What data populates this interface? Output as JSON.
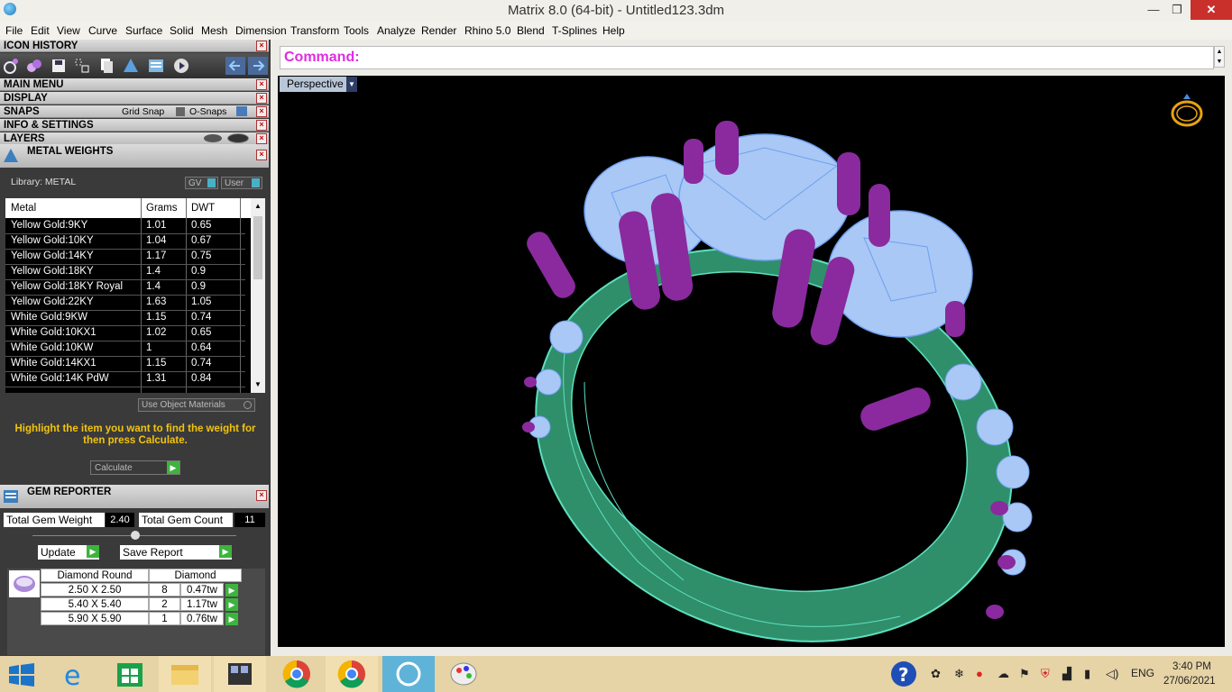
{
  "window": {
    "title": "Matrix 8.0 (64-bit) - Untitled123.3dm",
    "minimize": "—",
    "maximize": "❐",
    "close": "✕"
  },
  "menu": [
    "File",
    "Edit",
    "View",
    "Curve",
    "Surface",
    "Solid",
    "Mesh",
    "Dimension",
    "Transform",
    "Tools",
    "Analyze",
    "Render",
    "Rhino 5.0",
    "Blend",
    "T-Splines",
    "Help"
  ],
  "panels": {
    "icon_history": "ICON HISTORY",
    "main_menu": "MAIN MENU",
    "display": "DISPLAY",
    "snaps": "SNAPS",
    "grid_snap": "Grid Snap",
    "o_snaps": "O-Snaps",
    "info_settings": "INFO & SETTINGS",
    "layers": "LAYERS"
  },
  "metal_weights": {
    "title": "METAL WEIGHTS",
    "library": "Library: METAL",
    "gv": "GV",
    "user": "User",
    "columns": [
      "Metal",
      "Grams",
      "DWT"
    ],
    "rows": [
      [
        "Yellow Gold:9KY",
        "1.01",
        "0.65"
      ],
      [
        "Yellow Gold:10KY",
        "1.04",
        "0.67"
      ],
      [
        "Yellow Gold:14KY",
        "1.17",
        "0.75"
      ],
      [
        "Yellow Gold:18KY",
        "1.4",
        "0.9"
      ],
      [
        "Yellow Gold:18KY Royal",
        "1.4",
        "0.9"
      ],
      [
        "Yellow Gold:22KY",
        "1.63",
        "1.05"
      ],
      [
        "White Gold:9KW",
        "1.15",
        "0.74"
      ],
      [
        "White Gold:10KX1",
        "1.02",
        "0.65"
      ],
      [
        "White Gold:10KW",
        "1",
        "0.64"
      ],
      [
        "White Gold:14KX1",
        "1.15",
        "0.74"
      ],
      [
        "White Gold:14K PdW",
        "1.31",
        "0.84"
      ]
    ],
    "use_object_materials": "Use Object Materials",
    "hint": "Highlight the item you want to find the weight for then press Calculate.",
    "calculate": "Calculate"
  },
  "gem_reporter": {
    "title": "GEM REPORTER",
    "total_weight_label": "Total Gem Weight",
    "total_weight": "2.40",
    "total_count_label": "Total Gem Count",
    "total_count": "11",
    "update": "Update",
    "save_report": "Save Report",
    "col_shape": "Diamond Round",
    "col_material": "Diamond",
    "rows": [
      [
        "2.50 X 2.50",
        "8",
        "0.47tw"
      ],
      [
        "5.40 X 5.40",
        "2",
        "1.17tw"
      ],
      [
        "5.90 X 5.90",
        "1",
        "0.76tw"
      ]
    ]
  },
  "command": {
    "label": "Command:"
  },
  "viewport": {
    "name": "Perspective"
  },
  "taskbar": {
    "lang": "ENG",
    "time": "3:40 PM",
    "date": "27/06/2021"
  },
  "colors": {
    "metal": "#2f8f6a",
    "gem": "#a9c8f5",
    "prong": "#8a2a9e",
    "command_label": "#e02de0",
    "hint": "#f2c40d"
  },
  "icons": [
    "ring-icon",
    "gem-icon",
    "save-icon",
    "transform-icon",
    "copy-icon",
    "metal-weight-icon",
    "gem-report-icon",
    "play-icon",
    "arrow-left-icon",
    "arrow-right-icon"
  ]
}
